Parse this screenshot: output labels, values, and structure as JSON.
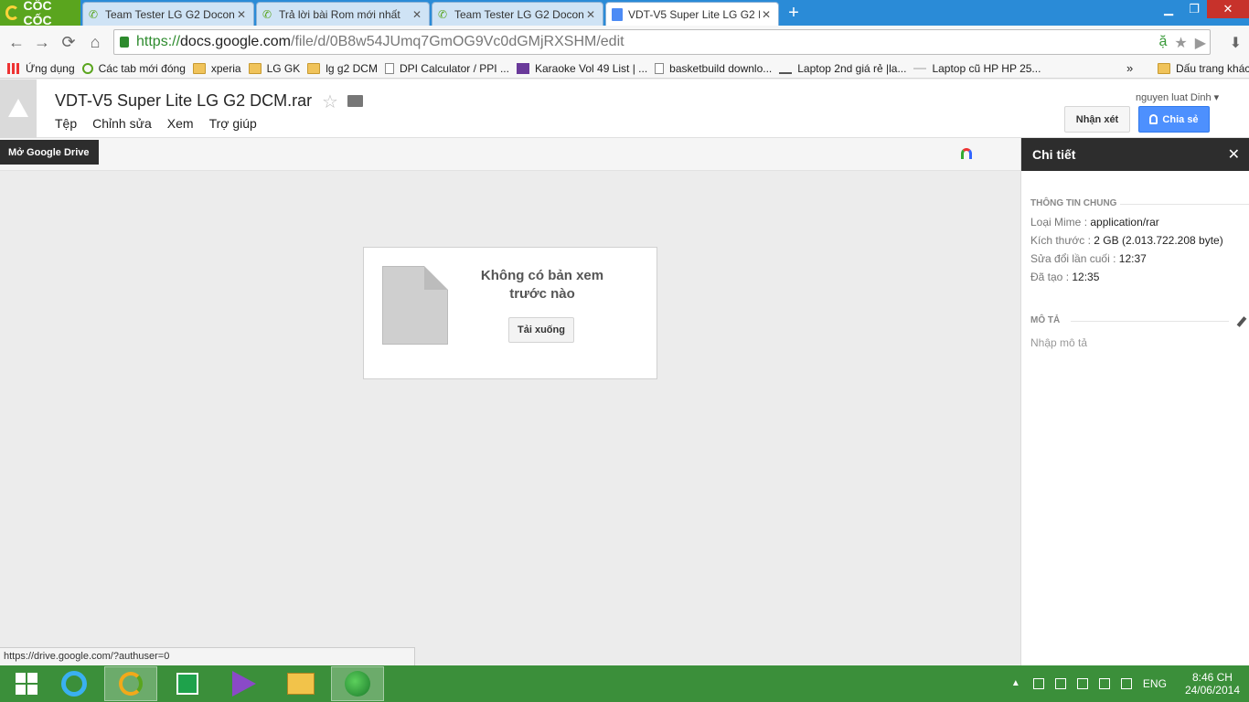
{
  "browser": {
    "logo_text": "CỐC CỐC",
    "tabs": [
      {
        "title": "Team Tester LG G2 Docon",
        "active": false
      },
      {
        "title": "Trả lời bài Rom mới nhất",
        "active": false
      },
      {
        "title": "Team Tester LG G2 Docon",
        "active": false
      },
      {
        "title": "VDT-V5 Super Lite LG G2 D",
        "active": true
      }
    ],
    "close_glyph": "✕",
    "new_tab_glyph": "+",
    "window_buttons": {
      "minimize": "▁",
      "maximize": "❐",
      "close": "✕"
    },
    "nav": {
      "back": "←",
      "forward": "→",
      "reload": "⟳",
      "home": "⌂"
    },
    "url_scheme": "https://",
    "url_host": "docs.google.com",
    "url_path": "/file/d/0B8w54JUmq7GmOG9Vc0dGMjRXSHM/edit",
    "omni_icons": {
      "translate": "ặ",
      "star": "★",
      "cast": "▶",
      "download": "⬇"
    }
  },
  "bookmarks": {
    "items": [
      {
        "label": "Ứng dụng",
        "icon": "apps-icon"
      },
      {
        "label": "Các tab mới đóng",
        "icon": "recent-tabs-icon"
      },
      {
        "label": "xperia",
        "icon": "folder-icon"
      },
      {
        "label": "LG GK",
        "icon": "folder-icon"
      },
      {
        "label": "lg g2 DCM",
        "icon": "folder-icon"
      },
      {
        "label": "DPI Calculator / PPI ...",
        "icon": "page-icon"
      },
      {
        "label": "Karaoke Vol 49 List | ...",
        "icon": "chart-icon"
      },
      {
        "label": "basketbuild downlo...",
        "icon": "page-icon"
      },
      {
        "label": "Laptop 2nd giá rẻ |la...",
        "icon": "cart-icon"
      },
      {
        "label": "Laptop cũ HP HP 25...",
        "icon": "dash-icon"
      }
    ],
    "more": "»",
    "other_label": "Dấu trang khác"
  },
  "drive": {
    "file_name": "VDT-V5 Super Lite LG G2 DCM.rar",
    "star_glyph": "☆",
    "menu": [
      "Tệp",
      "Chỉnh sửa",
      "Xem",
      "Trợ giúp"
    ],
    "user_name": "nguyen luat Dinh ▾",
    "comment_label": "Nhận xét",
    "share_label": "Chia sẻ",
    "tooltip": "Mở Google Drive"
  },
  "preview": {
    "message": "Không có bản xem trước nào",
    "download_label": "Tải xuống"
  },
  "details": {
    "title": "Chi tiết",
    "close_glyph": "✕",
    "general_heading": "THÔNG TIN CHUNG",
    "rows": [
      {
        "key": "Loại Mime :",
        "value": "application/rar"
      },
      {
        "key": "Kích thước :",
        "value": "2 GB (2.013.722.208 byte)"
      },
      {
        "key": "Sửa đổi lần cuối :",
        "value": "12:37"
      },
      {
        "key": "Đã tạo :",
        "value": "12:35"
      }
    ],
    "description_heading": "MÔ TẢ",
    "description_placeholder": "Nhập mô tả"
  },
  "status_url": "https://drive.google.com/?authuser=0",
  "taskbar": {
    "language": "ENG",
    "time": "8:46 CH",
    "date": "24/06/2014",
    "tray_caret": "▲"
  },
  "colors": {
    "tab_strip": "#2a8bd7",
    "taskbar": "#3b8f3a",
    "share_button": "#4d90fe",
    "details_header": "#2d2d2d"
  }
}
